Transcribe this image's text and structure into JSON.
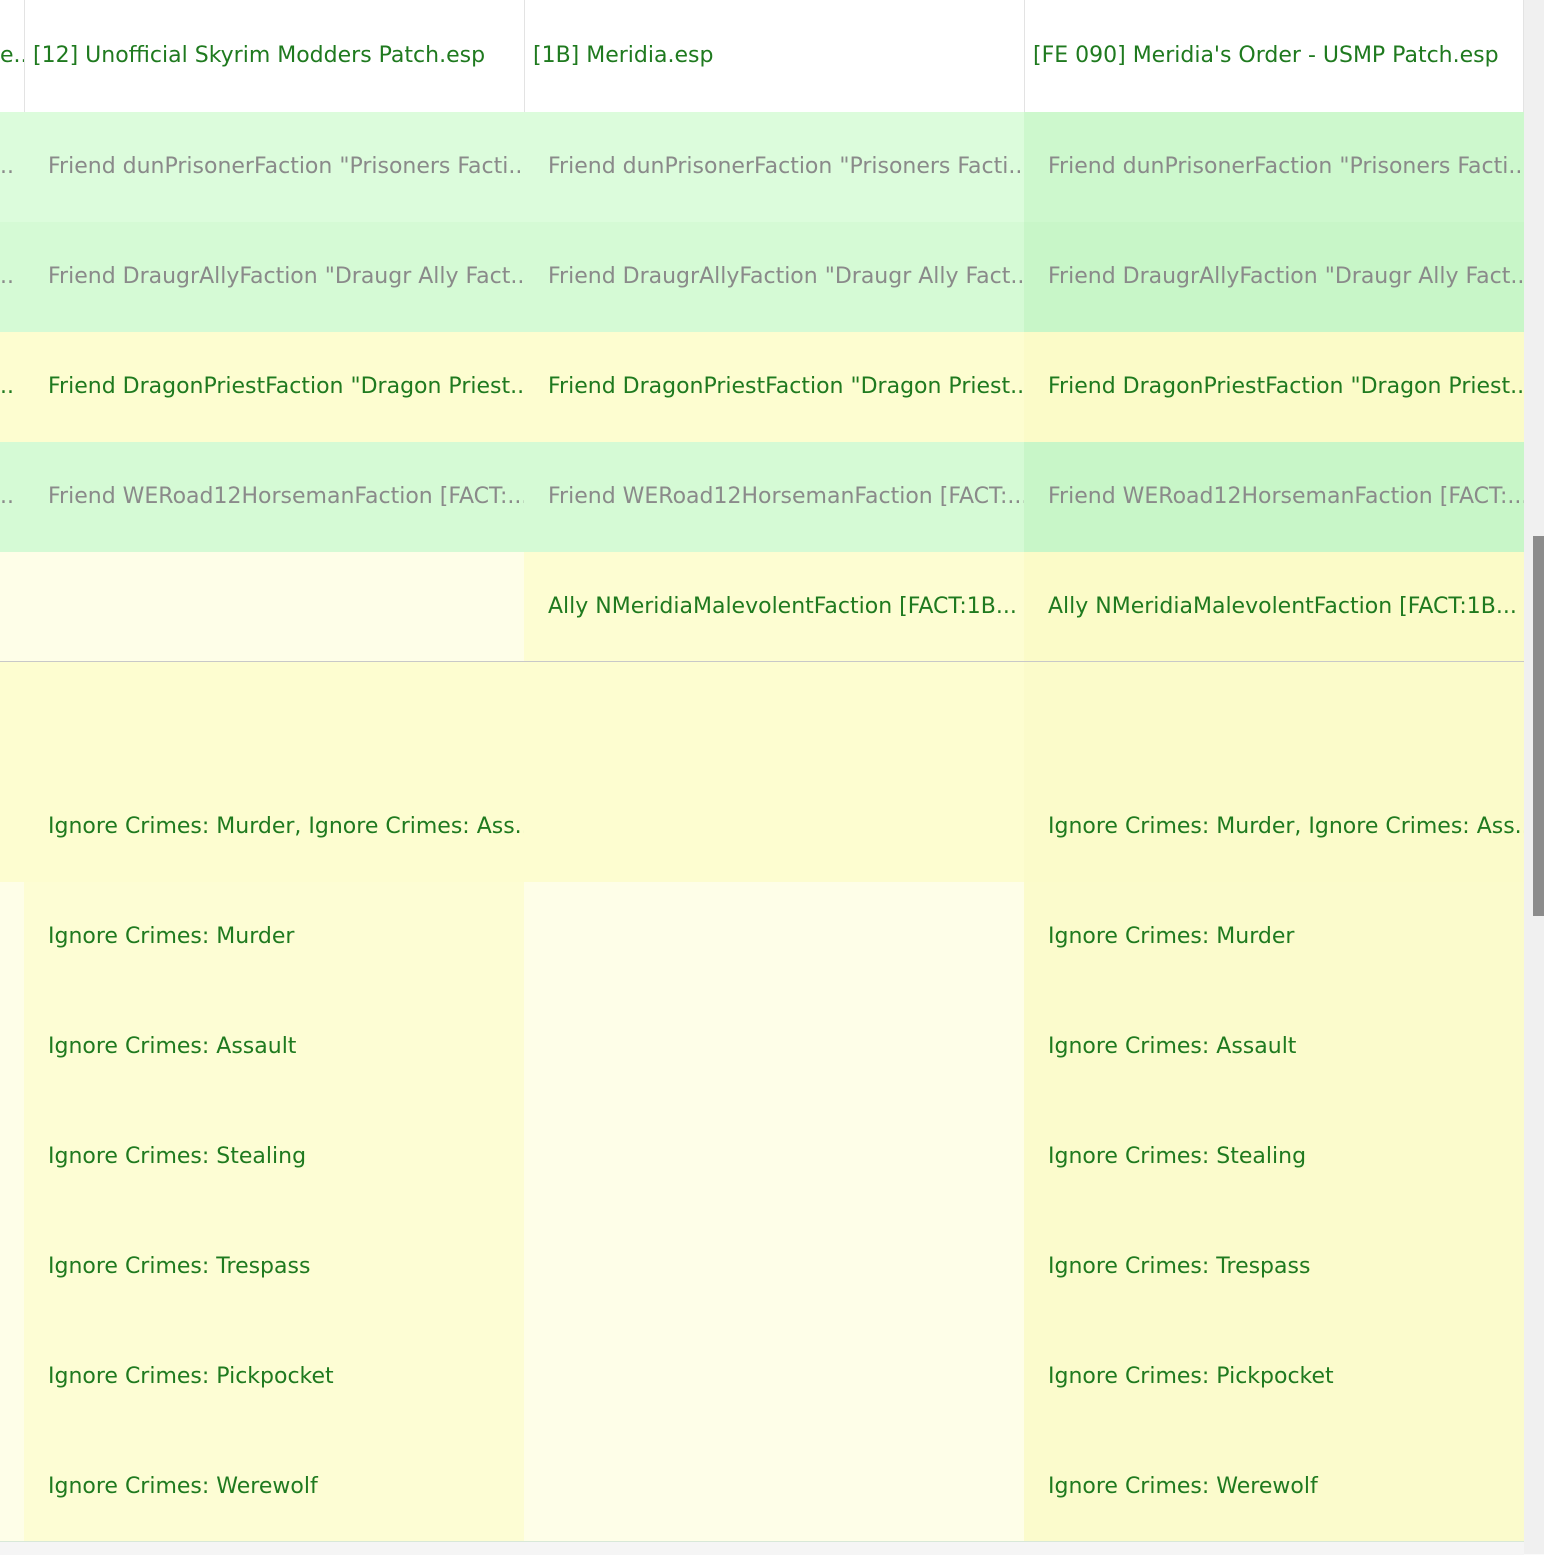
{
  "headers": {
    "col0": "e...",
    "col1": "[12] Unofficial Skyrim Modders Patch.esp",
    "col2": "[1B] Meridia.esp",
    "col3": "[FE 090] Meridia's Order - USMP Patch.esp"
  },
  "rows": [
    {
      "c0": "..",
      "c1": "Friend dunPrisonerFaction \"Prisoners Facti...",
      "c2": "Friend dunPrisonerFaction \"Prisoners Facti...",
      "c3": "Friend dunPrisonerFaction \"Prisoners Facti..."
    },
    {
      "c0": "..",
      "c1": "Friend DraugrAllyFaction \"Draugr Ally Fact...",
      "c2": "Friend DraugrAllyFaction \"Draugr Ally Fact...",
      "c3": "Friend DraugrAllyFaction \"Draugr Ally Fact..."
    },
    {
      "c0": "..",
      "c1": "Friend DragonPriestFaction \"Dragon Priest...",
      "c2": "Friend DragonPriestFaction \"Dragon Priest...",
      "c3": "Friend DragonPriestFaction \"Dragon Priest..."
    },
    {
      "c0": "..",
      "c1": "Friend WERoad12HorsemanFaction [FACT:...",
      "c2": "Friend WERoad12HorsemanFaction [FACT:...",
      "c3": "Friend WERoad12HorsemanFaction [FACT:..."
    },
    {
      "c0": "",
      "c1": "",
      "c2": "Ally NMeridiaMalevolentFaction [FACT:1B...",
      "c3": "Ally NMeridiaMalevolentFaction [FACT:1B..."
    },
    {
      "c0": "",
      "c1": "",
      "c2": "",
      "c3": ""
    },
    {
      "c0": "",
      "c1": "Ignore Crimes: Murder, Ignore Crimes: Ass...",
      "c2": "",
      "c3": "Ignore Crimes: Murder, Ignore Crimes: Ass..."
    },
    {
      "c0": "",
      "c1": "Ignore Crimes: Murder",
      "c2": "",
      "c3": "Ignore Crimes: Murder"
    },
    {
      "c0": "",
      "c1": "Ignore Crimes: Assault",
      "c2": "",
      "c3": "Ignore Crimes: Assault"
    },
    {
      "c0": "",
      "c1": "Ignore Crimes: Stealing",
      "c2": "",
      "c3": "Ignore Crimes: Stealing"
    },
    {
      "c0": "",
      "c1": "Ignore Crimes: Trespass",
      "c2": "",
      "c3": "Ignore Crimes: Trespass"
    },
    {
      "c0": "",
      "c1": "Ignore Crimes: Pickpocket",
      "c2": "",
      "c3": "Ignore Crimes: Pickpocket"
    },
    {
      "c0": "",
      "c1": "Ignore Crimes: Werewolf",
      "c2": "",
      "c3": "Ignore Crimes: Werewolf"
    }
  ],
  "colors": {
    "text_green": "#1f7a1f",
    "text_grey": "#8a8a8a",
    "bg_light_green": "#dcfcdc",
    "bg_green": "#cdf8cd",
    "bg_yellow": "#fdfdd0",
    "bg_pale_yellow": "#fefee6"
  }
}
